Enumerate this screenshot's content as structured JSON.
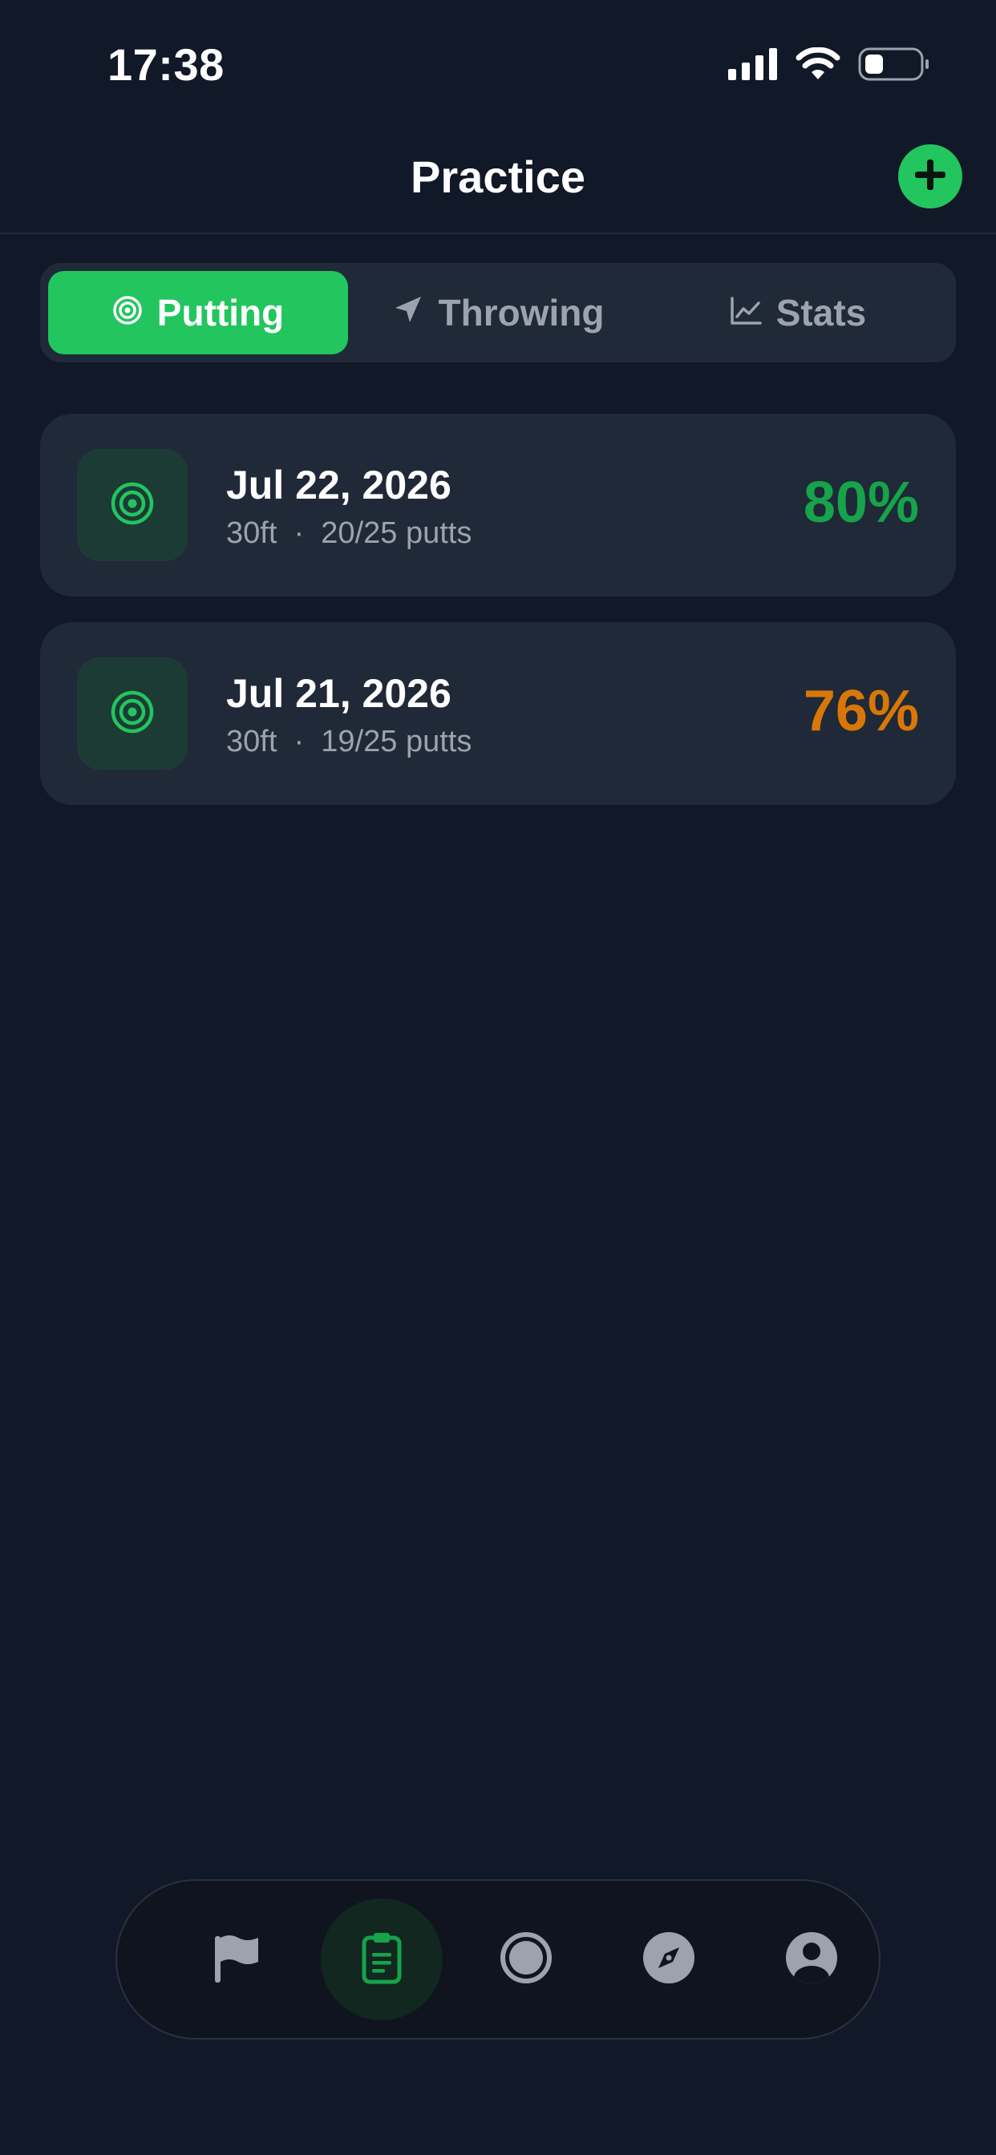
{
  "status_bar": {
    "time": "17:38"
  },
  "header": {
    "title": "Practice"
  },
  "tabs": [
    {
      "label": "Putting",
      "icon": "target-icon",
      "active": true
    },
    {
      "label": "Throwing",
      "icon": "navigation-arrow-icon",
      "active": false
    },
    {
      "label": "Stats",
      "icon": "line-chart-icon",
      "active": false
    }
  ],
  "sessions": [
    {
      "date": "Jul 22, 2026",
      "distance": "30ft",
      "separator": "·",
      "putts": "20/25 putts",
      "percent": "80%",
      "percent_color": "#16a34a"
    },
    {
      "date": "Jul 21, 2026",
      "distance": "30ft",
      "separator": "·",
      "putts": "19/25 putts",
      "percent": "76%",
      "percent_color": "#d97706"
    }
  ],
  "bottom_nav": [
    {
      "icon": "flag-icon",
      "active": false
    },
    {
      "icon": "clipboard-icon",
      "active": true
    },
    {
      "icon": "circle-disc-icon",
      "active": false
    },
    {
      "icon": "compass-icon",
      "active": false
    },
    {
      "icon": "profile-icon",
      "active": false
    }
  ],
  "colors": {
    "background": "#111827",
    "card": "#1f2937",
    "accent": "#22c55e",
    "muted_text": "#9ca3af"
  }
}
